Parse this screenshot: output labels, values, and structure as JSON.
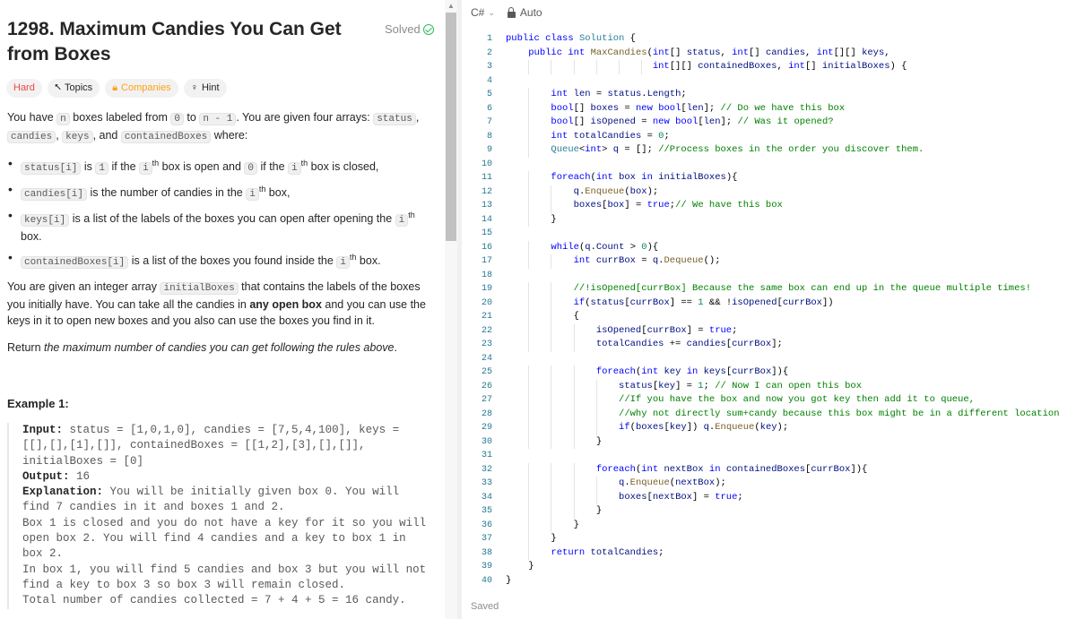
{
  "problem": {
    "title": "1298. Maximum Candies You Can Get from Boxes",
    "solved_label": "Solved",
    "tags": {
      "difficulty": "Hard",
      "topics": "Topics",
      "companies": "Companies",
      "hint": "Hint"
    },
    "intro": {
      "p1": "You have ",
      "n": "n",
      "p2": " boxes labeled from ",
      "zero": "0",
      "p3": " to ",
      "nminus": "n - 1",
      "p4": ". You are given four arrays: ",
      "status": "status",
      "p5": ",",
      "candies": "candies",
      "p6": ", ",
      "keys": "keys",
      "p7": ", and ",
      "contained": "containedBoxes",
      "p8": " where:"
    },
    "bullets": {
      "b1": {
        "code1": "status[i]",
        "t1": " is ",
        "one": "1",
        "t2": " if the ",
        "ith": "i",
        "th": "th",
        "t3": " box is open and ",
        "zero": "0",
        "t4": " if the ",
        "ith2": "i",
        "th2": "th",
        "t5": " box is closed,"
      },
      "b2": {
        "code1": "candies[i]",
        "t1": " is the number of candies in the ",
        "ith": "i",
        "th": "th",
        "t2": " box,"
      },
      "b3": {
        "code1": "keys[i]",
        "t1": " is a list of the labels of the boxes you can open after opening the ",
        "ith": "i",
        "th": "th",
        "t2": " box."
      },
      "b4": {
        "code1": "containedBoxes[i]",
        "t1": " is a list of the boxes you found inside the ",
        "ith": "i",
        "th": "th",
        "t2": " box."
      }
    },
    "para2": {
      "t1": "You are given an integer array ",
      "code": "initialBoxes",
      "t2": " that contains the labels of the boxes you initially have. You can take all the candies in ",
      "bold": "any open box",
      "t3": " and you can use the keys in it to open new boxes and you also can use the boxes you find in it."
    },
    "para3": {
      "t1": "Return ",
      "italic": "the maximum number of candies you can get following the rules above",
      "t2": "."
    },
    "example": {
      "title": "Example 1:",
      "input_label": "Input:",
      "input_value": " status = [1,0,1,0], candies = [7,5,4,100], keys = [[],[],[1],[]], containedBoxes = [[1,2],[3],[],[]], initialBoxes = [0]",
      "output_label": "Output:",
      "output_value": " 16",
      "explanation_label": "Explanation:",
      "explanation_value": " You will be initially given box 0. You will find 7 candies in it and boxes 1 and 2.",
      "line2": "Box 1 is closed and you do not have a key for it so you will open box 2. You will find 4 candies and a key to box 1 in box 2.",
      "line3": "In box 1, you will find 5 candies and box 3 but you will not find a key to box 3 so box 3 will remain closed.",
      "line4": "Total number of candies collected = 7 + 4 + 5 = 16 candy."
    }
  },
  "editor": {
    "language": "C#",
    "mode": "Auto",
    "status": "Saved",
    "lines": [
      "public class Solution {",
      "    public int MaxCandies(int[] status, int[] candies, int[][] keys,",
      "                          int[][] containedBoxes, int[] initialBoxes) {",
      "",
      "        int len = status.Length;",
      "        bool[] boxes = new bool[len]; // Do we have this box",
      "        bool[] isOpened = new bool[len]; // Was it opened?",
      "        int totalCandies = 0;",
      "        Queue<int> q = []; //Process boxes in the order you discover them.",
      "",
      "        foreach(int box in initialBoxes){",
      "            q.Enqueue(box);",
      "            boxes[box] = true;// We have this box",
      "        }",
      "",
      "        while(q.Count > 0){",
      "            int currBox = q.Dequeue();",
      "",
      "            //!isOpened[currBox] Because the same box can end up in the queue multiple times!",
      "            if(status[currBox] == 1 && !isOpened[currBox])",
      "            {",
      "                isOpened[currBox] = true;",
      "                totalCandies += candies[currBox];",
      "",
      "                foreach(int key in keys[currBox]){",
      "                    status[key] = 1; // Now I can open this box",
      "                    //If you have the box and now you got key then add it to queue,",
      "                    //why not directly sum+candy because this box might be in a different location",
      "                    if(boxes[key]) q.Enqueue(key);",
      "                }",
      "",
      "                foreach(int nextBox in containedBoxes[currBox]){",
      "                    q.Enqueue(nextBox);",
      "                    boxes[nextBox] = true;",
      "                }",
      "            }",
      "        }",
      "        return totalCandies;",
      "    }",
      "}"
    ]
  }
}
